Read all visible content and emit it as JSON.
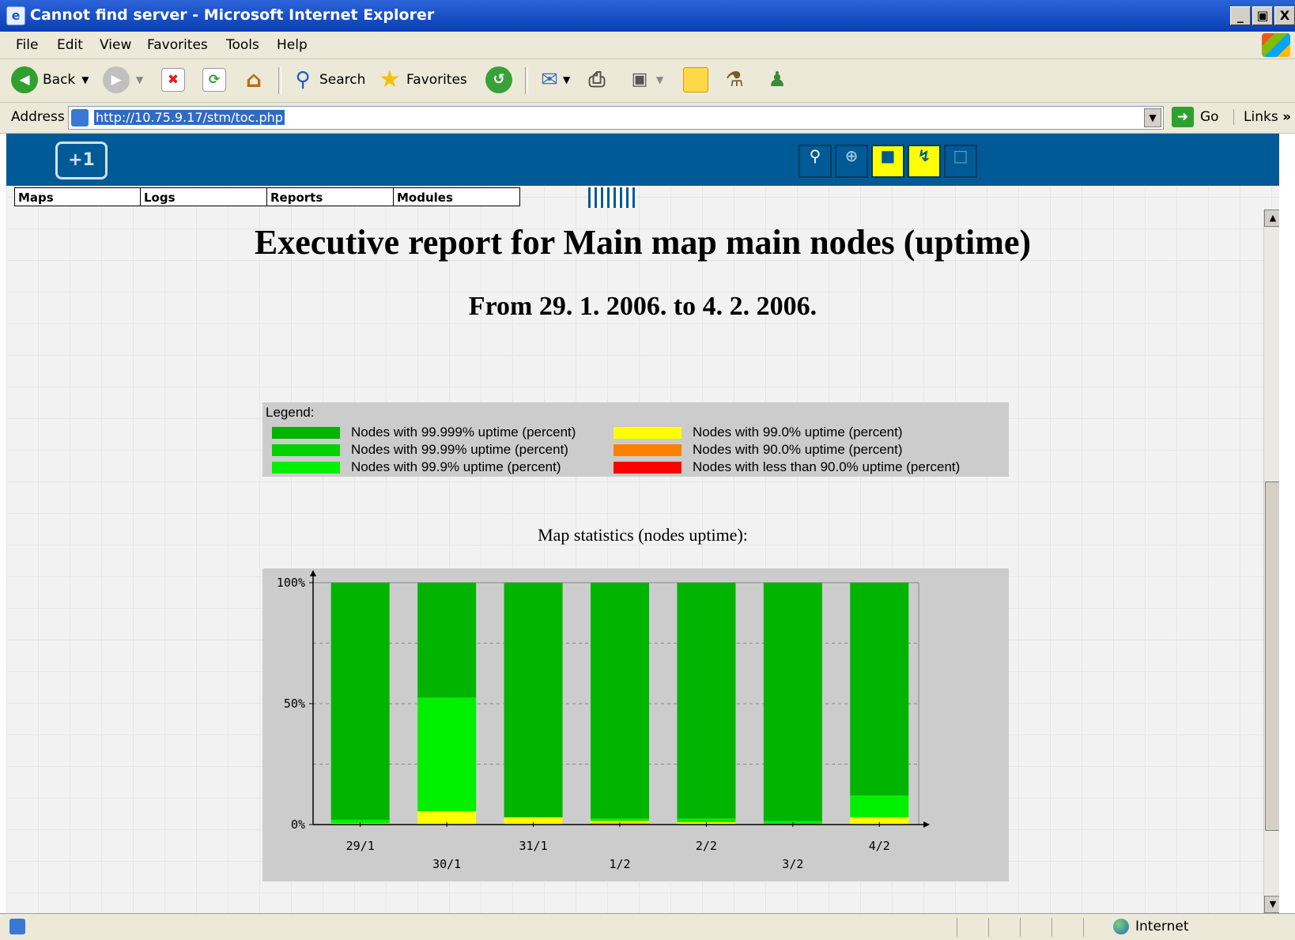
{
  "window": {
    "title": "Cannot find server - Microsoft Internet Explorer",
    "buttons": [
      "_",
      "·",
      "X"
    ]
  },
  "menu": [
    "File",
    "Edit",
    "View",
    "Favorites",
    "Tools",
    "Help"
  ],
  "toolbar": {
    "back": "Back",
    "search": "Search",
    "favorites": "Favorites"
  },
  "address": {
    "label": "Address",
    "url": "http://10.75.9.17/stm/toc.php",
    "go": "Go",
    "links": "Links"
  },
  "nav": [
    "Maps",
    "Logs",
    "Reports",
    "Modules"
  ],
  "report": {
    "title": "Executive report for Main map main nodes (uptime)",
    "subtitle": "From 29. 1. 2006. to 4. 2. 2006.",
    "legend_title": "Legend:",
    "legend": [
      {
        "label": "Nodes with 99.999% uptime (percent)",
        "color": "#00b400"
      },
      {
        "label": "Nodes with 99.99% uptime (percent)",
        "color": "#00d200"
      },
      {
        "label": "Nodes with 99.9% uptime (percent)",
        "color": "#00f000"
      },
      {
        "label": "Nodes with 99.0% uptime (percent)",
        "color": "#ffff00"
      },
      {
        "label": "Nodes with 90.0% uptime (percent)",
        "color": "#ff8000"
      },
      {
        "label": "Nodes with less than 90.0% uptime (percent)",
        "color": "#ff0000"
      }
    ],
    "chart_title": "Map statistics (nodes uptime):"
  },
  "chart_data": {
    "type": "bar",
    "stacked": true,
    "title": "Map statistics (nodes uptime):",
    "categories": [
      "29/1",
      "30/1",
      "31/1",
      "1/2",
      "2/2",
      "3/2",
      "4/2"
    ],
    "yticks": [
      "0%",
      "50%",
      "100%"
    ],
    "ylim": [
      0,
      100
    ],
    "grid": true,
    "series": [
      {
        "name": "Nodes with less than 90.0% uptime (percent)",
        "color": "#ff0000",
        "values": [
          0,
          0,
          0,
          0,
          0,
          0,
          0
        ]
      },
      {
        "name": "Nodes with 90.0% uptime (percent)",
        "color": "#ff8000",
        "values": [
          0,
          0,
          0,
          0.5,
          0,
          0.5,
          0
        ]
      },
      {
        "name": "Nodes with 99.0% uptime (percent)",
        "color": "#ffff00",
        "values": [
          0.5,
          5.5,
          3,
          1,
          1,
          0,
          3
        ]
      },
      {
        "name": "Nodes with 99.9% uptime (percent)",
        "color": "#00f000",
        "values": [
          1.5,
          47,
          0,
          1,
          1.5,
          1,
          9
        ]
      },
      {
        "name": "Nodes with 99.99% uptime (percent)",
        "color": "#00d200",
        "values": [
          0,
          0,
          0,
          0,
          0,
          0,
          0
        ]
      },
      {
        "name": "Nodes with 99.999% uptime (percent)",
        "color": "#00b400",
        "values": [
          98,
          47.5,
          97,
          97.5,
          97.5,
          98.5,
          88
        ]
      }
    ]
  },
  "status": {
    "zone": "Internet"
  }
}
